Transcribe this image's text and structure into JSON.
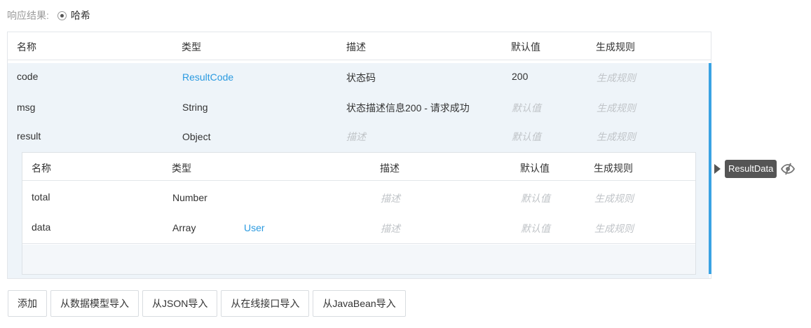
{
  "response": {
    "label": "响应结果:",
    "option": "哈希"
  },
  "columns": {
    "name": "名称",
    "type": "类型",
    "desc": "描述",
    "default": "默认值",
    "rule": "生成规则"
  },
  "rows": [
    {
      "name": "code",
      "type": "ResultCode",
      "desc": "状态码",
      "default": "200",
      "rule": "生成规则"
    },
    {
      "name": "msg",
      "type": "String",
      "desc": "状态描述信息200 - 请求成功",
      "default": "默认值",
      "rule": "生成规则"
    },
    {
      "name": "result",
      "type": "Object",
      "desc": "描述",
      "default": "默认值",
      "rule": "生成规则"
    }
  ],
  "nested": {
    "columns": {
      "name": "名称",
      "type": "类型",
      "desc": "描述",
      "default": "默认值",
      "rule": "生成规则"
    },
    "rows": [
      {
        "name": "total",
        "type": "Number",
        "desc": "描述",
        "default": "默认值",
        "rule": "生成规则"
      },
      {
        "name": "data",
        "type": "Array",
        "subtype": "User",
        "desc": "描述",
        "default": "默认值",
        "rule": "生成规则"
      }
    ]
  },
  "tag": {
    "label": "ResultData",
    "icon": "eye-slash-icon"
  },
  "buttons": {
    "add": "添加",
    "from_model": "从数据模型导入",
    "from_json": "从JSON导入",
    "from_online": "从在线接口导入",
    "from_javabean": "从JavaBean导入"
  },
  "colors": {
    "accent": "#3aa3e3",
    "link": "#2a9ae0",
    "row_bg": "#eef4f9",
    "tag_bg": "#555555"
  }
}
